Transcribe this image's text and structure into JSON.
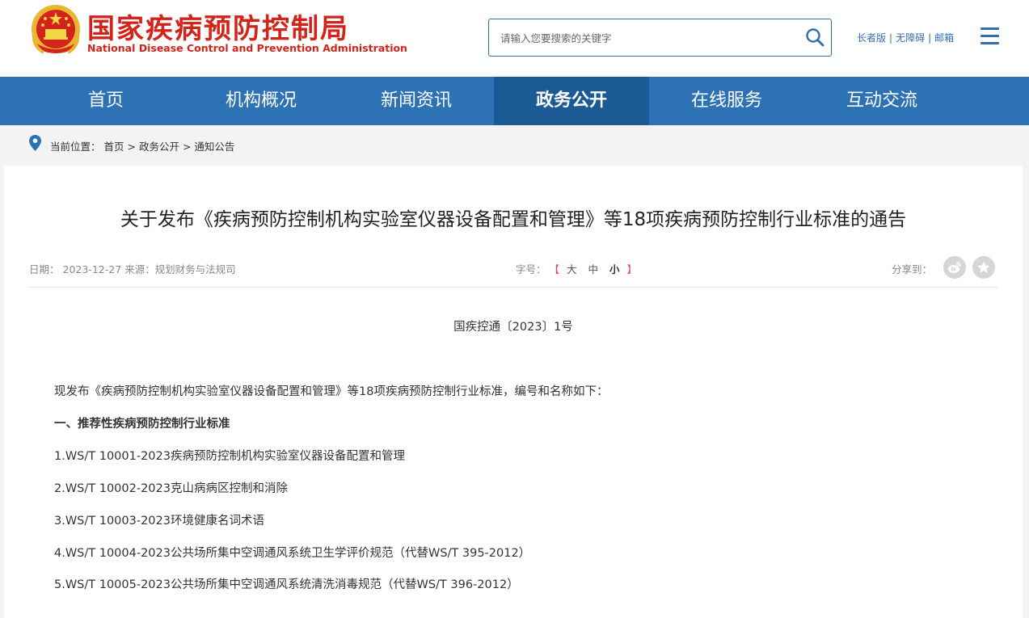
{
  "header": {
    "title_cn": "国家疾病预防控制局",
    "title_en": "National Disease Control and Prevention Administration",
    "emblem_icon": "national-emblem-icon",
    "search": {
      "placeholder": "请输入您要搜索的关键字",
      "value": ""
    },
    "links": [
      "长者版",
      "无障碍",
      "邮箱"
    ]
  },
  "nav": {
    "items": [
      "首页",
      "机构概况",
      "新闻资讯",
      "政务公开",
      "在线服务",
      "互动交流"
    ],
    "active": "政务公开"
  },
  "breadcrumb": {
    "label": "当前位置：",
    "items": [
      "首页",
      "政务公开",
      "通知公告"
    ]
  },
  "article": {
    "title": "关于发布《疾病预防控制机构实验室仪器设备配置和管理》等18项疾病预防控制行业标准的通告",
    "date_label": "日期：",
    "date": "2023-12-27",
    "source_label": "来源：",
    "source": "规划财务与法规司",
    "fontsize_label": "字号：",
    "fontsizes": [
      "大",
      "中",
      "小"
    ],
    "fontsize_selected": "小",
    "share_label": "分享到：",
    "doc_number": "国疾控通〔2023〕1号",
    "paragraphs": [
      "现发布《疾病预防控制机构实验室仪器设备配置和管理》等18项疾病预防控制行业标准，编号和名称如下：",
      "一、推荐性疾病预防控制行业标准",
      "1.WS/T 10001-2023疾病预防控制机构实验室仪器设备配置和管理",
      "2.WS/T 10002-2023克山病病区控制和消除",
      "3.WS/T 10003-2023环境健康名词术语",
      "4.WS/T 10004-2023公共场所集中空调通风系统卫生学评价规范（代替WS/T 395-2012）",
      "5.WS/T 10005-2023公共场所集中空调通风系统清洗消毒规范（代替WS/T 396-2012）"
    ]
  },
  "colors": {
    "brand_red": "#d4231b",
    "nav_blue": "#2c72b5",
    "nav_active": "#1b5a95",
    "link_blue": "#2f6fae"
  }
}
